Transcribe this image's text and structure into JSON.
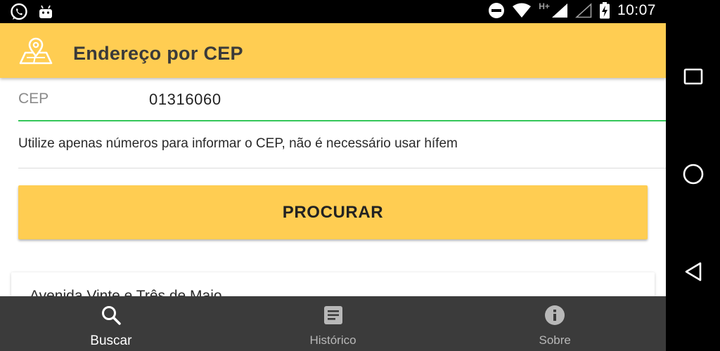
{
  "status_bar": {
    "time": "10:07",
    "network_label": "H+",
    "left_icons": [
      "whatsapp-icon",
      "android-icon"
    ],
    "right_icons": [
      "do-not-disturb-icon",
      "wifi-icon",
      "signal-icon",
      "signal-empty-icon",
      "battery-charging-icon"
    ]
  },
  "app_bar": {
    "title": "Endereço por CEP",
    "icon": "map-pin-icon"
  },
  "form": {
    "cep_label": "CEP",
    "cep_value": "01316060",
    "hint": "Utilize apenas números para informar o CEP, não é necessário usar hífem",
    "search_button_label": "PROCURAR"
  },
  "result": {
    "street": "Avenida Vinte e Três de Maio"
  },
  "bottom_nav": {
    "items": [
      {
        "label": "Buscar",
        "icon": "search-icon",
        "active": true
      },
      {
        "label": "Histórico",
        "icon": "history-list-icon",
        "active": false
      },
      {
        "label": "Sobre",
        "icon": "info-icon",
        "active": false
      }
    ]
  },
  "colors": {
    "accent": "#ffcd52",
    "input_underline": "#34c759",
    "bottom_nav_bg": "#3b3b3b"
  }
}
